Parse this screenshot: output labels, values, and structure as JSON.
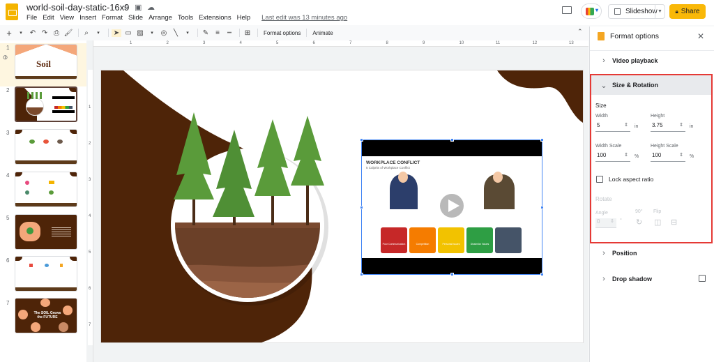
{
  "app": {
    "title": "world-soil-day-static-16x9",
    "menu": [
      "File",
      "Edit",
      "View",
      "Insert",
      "Format",
      "Slide",
      "Arrange",
      "Tools",
      "Extensions",
      "Help"
    ],
    "last_edit": "Last edit was 13 minutes ago",
    "slideshow_label": "Slideshow",
    "share_label": "Share",
    "brand_color": "#f4b400",
    "share_color": "#f9b808"
  },
  "toolbar": {
    "format_options_label": "Format options",
    "animate_label": "Animate"
  },
  "filmstrip": {
    "slides": [
      {
        "number": "1",
        "caption": "Soil"
      },
      {
        "number": "2",
        "caption": ""
      },
      {
        "number": "3",
        "caption": ""
      },
      {
        "number": "4",
        "caption": ""
      },
      {
        "number": "5",
        "caption": ""
      },
      {
        "number": "6",
        "caption": ""
      },
      {
        "number": "7",
        "caption": "The SOIL Grows the FUTURE"
      }
    ],
    "active_slide": "2"
  },
  "ruler": {
    "horizontal": [
      "1",
      "2",
      "3",
      "4",
      "5",
      "6",
      "7",
      "8",
      "9",
      "10",
      "11",
      "12",
      "13"
    ],
    "vertical": [
      "1",
      "2",
      "3",
      "4",
      "5",
      "6",
      "7"
    ]
  },
  "slide": {
    "video": {
      "title": "WORKPLACE CONFLICT",
      "subtitle": "5 Culprits of Workplace Conflict",
      "cards": [
        {
          "label": "Poor Communication",
          "color": "#c62828"
        },
        {
          "label": "Competition",
          "color": "#f57c00"
        },
        {
          "label": "Personal Issues",
          "color": "#f2c200"
        },
        {
          "label": "Dissimilar Values",
          "color": "#2e9e44"
        },
        {
          "label": "",
          "color": "#455468"
        }
      ]
    },
    "colors": {
      "soil_brown": "#4e2408",
      "tree_green": "#5a9b3a"
    }
  },
  "panel": {
    "title": "Format options",
    "sections": {
      "video_playback": "Video playback",
      "size_rotation": "Size & Rotation",
      "position": "Position",
      "drop_shadow": "Drop shadow"
    },
    "size": {
      "heading": "Size",
      "width_label": "Width",
      "width_value": "5",
      "width_unit": "in",
      "height_label": "Height",
      "height_value": "3.75",
      "height_unit": "in",
      "width_scale_label": "Width Scale",
      "width_scale_value": "100",
      "height_scale_label": "Height Scale",
      "height_scale_value": "100",
      "scale_unit": "%",
      "lock_label": "Lock aspect ratio",
      "lock_checked": false
    },
    "rotate": {
      "heading": "Rotate",
      "angle_label": "Angle",
      "angle_value": "0",
      "angle_unit": "°",
      "rotate90_label": "90°",
      "flip_label": "Flip"
    },
    "drop_shadow_checked": false,
    "highlight_color": "#e53935"
  }
}
